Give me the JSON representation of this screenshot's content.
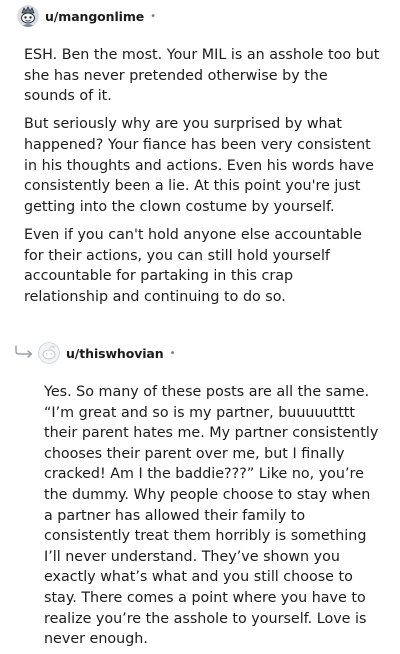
{
  "comments": [
    {
      "username": "u/mangonlime",
      "separator": "•",
      "avatar_icon": "snoo-avatar-icon",
      "paragraphs": [
        "ESH. Ben the most. Your MIL is an asshole too but she has never pretended otherwise by the sounds of it.",
        "But seriously why are you surprised by what happened? Your fiance has been very consistent in his thoughts and actions. Even his words have consistently been a lie. At this point you're just getting into the clown costume by yourself.",
        "Even if you can't hold anyone else accountable for their actions, you can still hold yourself accountable for partaking in this crap relationship and continuing to do so."
      ]
    },
    {
      "username": "u/thiswhovian",
      "separator": "•",
      "avatar_icon": "default-avatar-icon",
      "reply_icon": "reply-arrow-icon",
      "paragraphs": [
        "Yes. So many of these posts are all the same. “I’m great and so is my partner, buuuuutttt their parent hates me. My partner consistently chooses their parent over me, but I finally cracked! Am I the baddie???” Like no, you’re the dummy. Why people choose to stay when a partner has allowed their family to consistently treat them horribly is something I’ll never understand. They’ve shown you exactly what’s what and you still choose to stay. There comes a point where you have to realize you’re the asshole to yourself. Love is never enough."
      ]
    }
  ]
}
